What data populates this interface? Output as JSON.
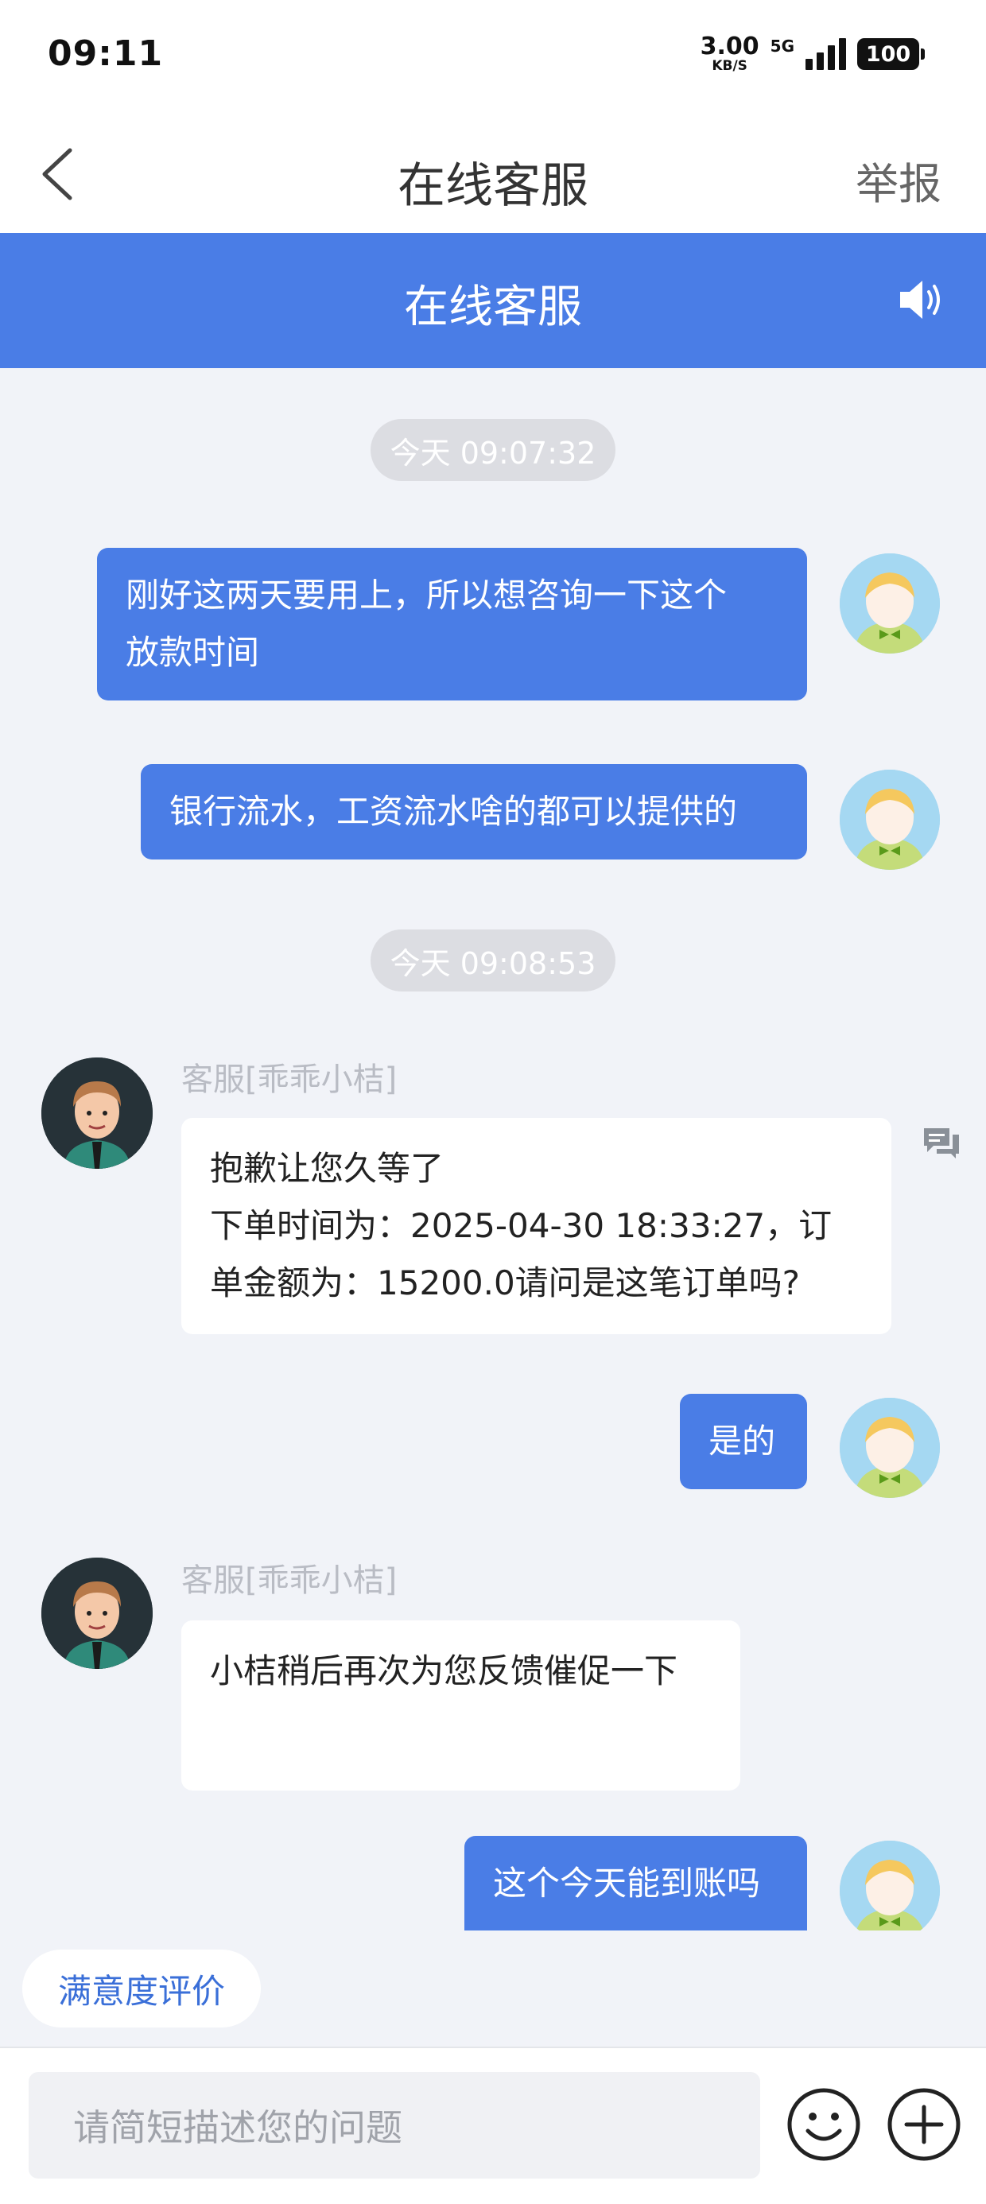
{
  "status_bar": {
    "time": "09:11",
    "net_speed": "3.00",
    "net_unit": "KB/S",
    "net_type": "5G",
    "battery": "100"
  },
  "nav": {
    "back_icon": "chevron-left-icon",
    "title": "在线客服",
    "report": "举报"
  },
  "header": {
    "title": "在线客服",
    "speaker_icon": "speaker-icon"
  },
  "messages": [
    {
      "type": "time",
      "text": "今天 09:07:32"
    },
    {
      "type": "user",
      "lines": [
        "刚好这两天要用上，所以想咨询一下这个",
        "放款时间"
      ]
    },
    {
      "type": "user",
      "lines": [
        "银行流水，工资流水啥的都可以提供的"
      ]
    },
    {
      "type": "time",
      "text": "今天 09:08:53"
    },
    {
      "type": "agent",
      "name": "客服[乖乖小桔]",
      "lines": [
        "抱歉让您久等了",
        "下单时间为：2025-04-30 18:33:27，订",
        "单金额为：15200.0请问是这笔订单吗?"
      ]
    },
    {
      "type": "user",
      "lines": [
        "是的"
      ]
    },
    {
      "type": "agent",
      "name": "客服[乖乖小桔]",
      "lines": [
        "小桔稍后再次为您反馈催促一下"
      ]
    },
    {
      "type": "user",
      "lines": [
        "这个今天能到账吗"
      ]
    }
  ],
  "satisfaction": {
    "label": "满意度评价"
  },
  "input": {
    "placeholder": "请简短描述您的问题",
    "emoji_icon": "smile-icon",
    "plus_icon": "plus-circle-icon"
  },
  "colors": {
    "accent": "#4a7de6",
    "background": "#f1f3f8",
    "agent_bubble": "#ffffff",
    "name_gray": "#b9bcc4"
  }
}
